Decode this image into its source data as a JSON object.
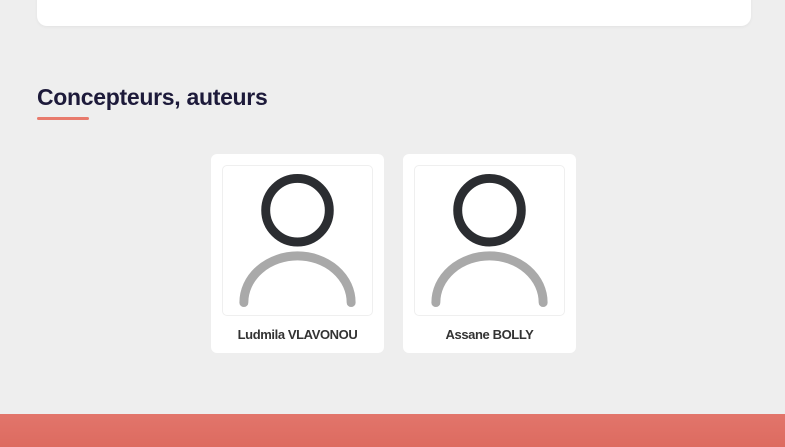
{
  "section": {
    "title": "Concepteurs, auteurs"
  },
  "people": [
    {
      "name": "Ludmila VLAVONOU",
      "avatar_icon": "default-user-avatar-icon"
    },
    {
      "name": "Assane BOLLY",
      "avatar_icon": "default-user-avatar-icon"
    }
  ],
  "colors": {
    "background": "#eeeeee",
    "accent": "#e87a6c",
    "title_text": "#1d1a3a",
    "avatar_head": "#2b2d31",
    "avatar_body": "#a9a9a9",
    "footer": "#e0706a"
  }
}
